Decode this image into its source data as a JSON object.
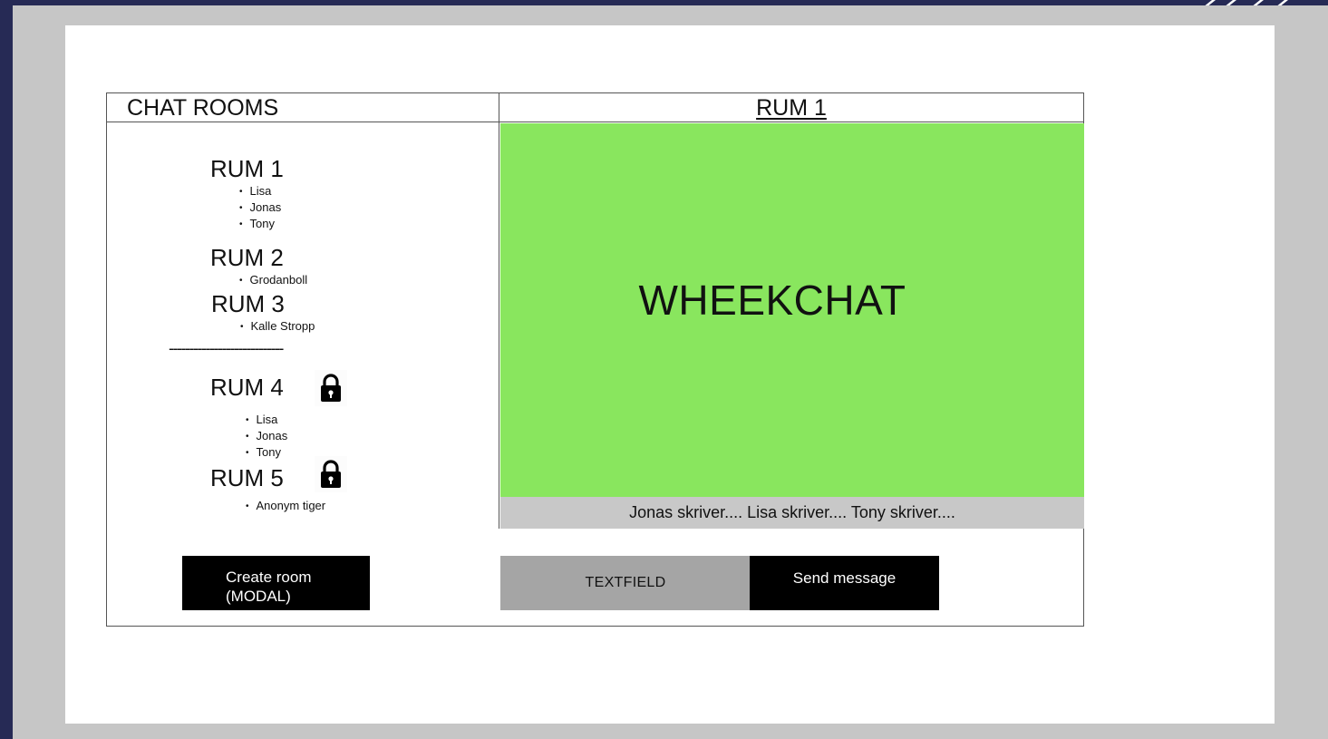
{
  "sidebar": {
    "title": "CHAT ROOMS",
    "rooms": [
      {
        "name": "RUM 1",
        "locked": false,
        "members": [
          "Lisa",
          "Jonas",
          "Tony"
        ]
      },
      {
        "name": "RUM 2",
        "locked": false,
        "members": [
          "Grodanboll"
        ]
      },
      {
        "name": "RUM 3",
        "locked": false,
        "members": [
          "Kalle Stropp"
        ]
      },
      {
        "name": "RUM 4",
        "locked": true,
        "icon": "lock-icon",
        "members": [
          "Lisa",
          "Jonas",
          "Tony"
        ]
      },
      {
        "name": "RUM 5",
        "locked": true,
        "icon": "lock-icon",
        "members": [
          "Anonym tiger"
        ]
      }
    ],
    "separator": "----------------------------",
    "create_button": {
      "line1": "Create room",
      "line2": "(MODAL)"
    }
  },
  "chat": {
    "title": "RUM 1",
    "brand": "WHEEKCHAT",
    "typing": "Jonas skriver.... Lisa skriver.... Tony skriver....",
    "input_placeholder": "TEXTFIELD",
    "send_label": "Send message",
    "accent": "#89e65e"
  }
}
